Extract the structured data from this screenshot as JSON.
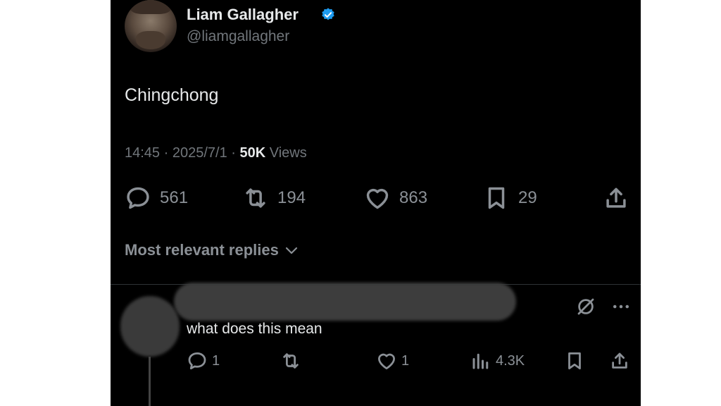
{
  "tweet": {
    "author_name": "Liam Gallagher",
    "author_handle": "@liamgallagher",
    "text": "Chingchong",
    "time": "14:45",
    "date": "2025/7/1",
    "views_count": "50K",
    "views_label": "Views",
    "replies": "561",
    "reposts": "194",
    "likes": "863",
    "bookmarks": "29"
  },
  "replies_section": {
    "sort_label": "Most relevant replies"
  },
  "reply": {
    "text": "what does this mean",
    "replies": "1",
    "likes": "1",
    "views": "4.3K"
  },
  "colors": {
    "background": "#000000",
    "text_primary": "#e7e9ea",
    "text_secondary": "#71767b",
    "verified": "#1d9bf0"
  }
}
